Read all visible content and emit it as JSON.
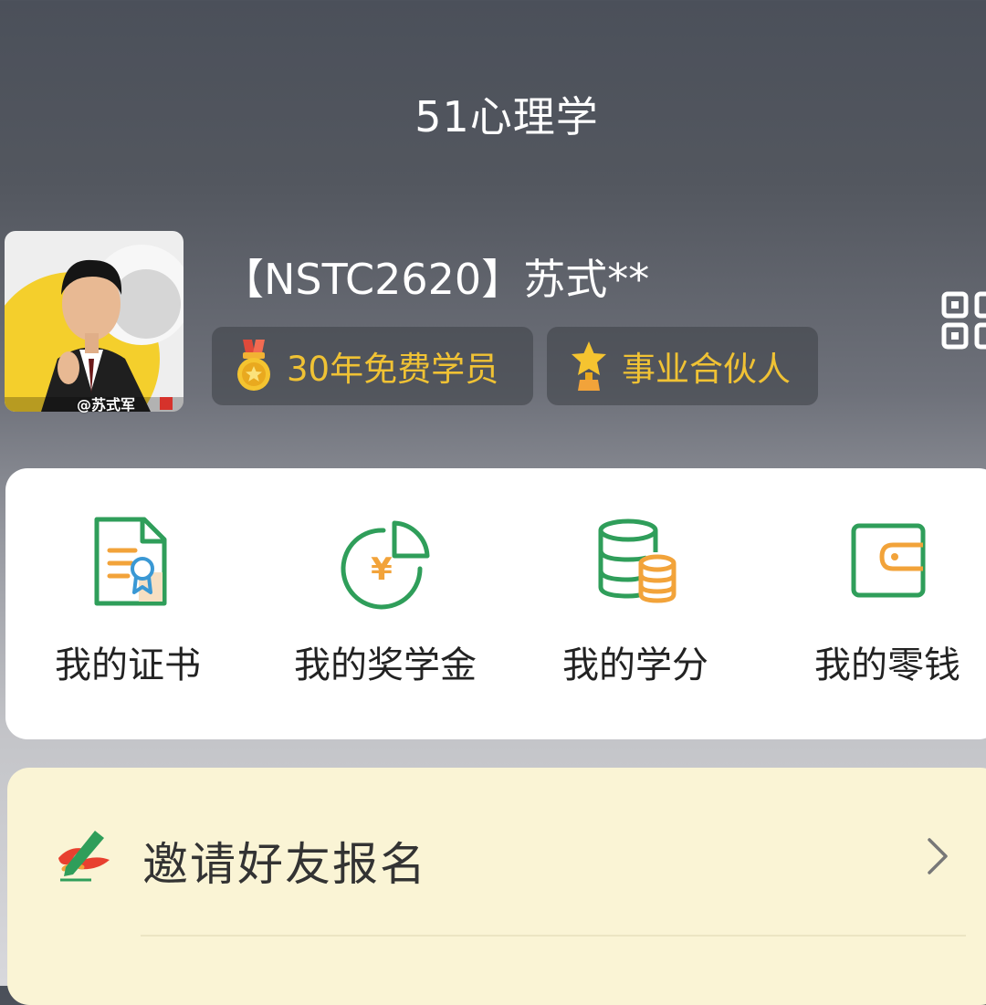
{
  "header": {
    "title": "51心理学"
  },
  "profile": {
    "avatar_caption": "@苏式军",
    "name": "【NSTC2620】苏式**",
    "badges": [
      {
        "icon": "medal-icon",
        "label": "30年免费学员"
      },
      {
        "icon": "star-trophy-icon",
        "label": "事业合伙人"
      }
    ],
    "qr_icon": "qr-code-icon"
  },
  "menu": {
    "items": [
      {
        "icon": "certificate-icon",
        "label": "我的证书"
      },
      {
        "icon": "scholarship-icon",
        "label": "我的奖学金"
      },
      {
        "icon": "credits-icon",
        "label": "我的学分"
      },
      {
        "icon": "wallet-icon",
        "label": "我的零钱"
      }
    ]
  },
  "invite": {
    "icon": "invite-pen-icon",
    "label": "邀请好友报名"
  },
  "colors": {
    "badge_text": "#f0c234",
    "icon_green": "#2f9e5a",
    "icon_orange": "#f2a33a",
    "invite_bg": "#faf4d5"
  }
}
